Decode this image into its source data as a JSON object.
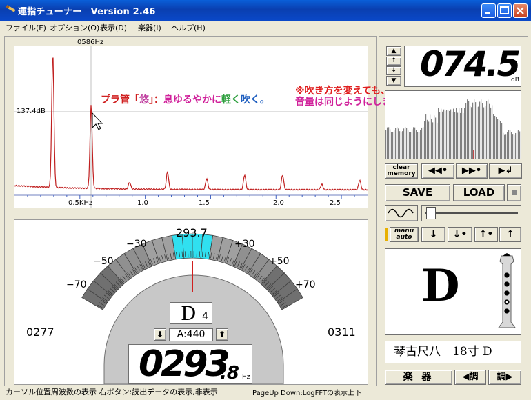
{
  "window": {
    "title": "運指チューナー　Version 2.46"
  },
  "menu": [
    "ファイル(F)",
    "オプション(O)",
    "表示(D)",
    "楽器(I)",
    "ヘルプ(H)"
  ],
  "spectrum": {
    "cursor_freq": "0586Hz",
    "cursor_db": "137.4dB",
    "x_ticks": [
      "0.5KHz",
      "1.0",
      "1.5",
      "2.0",
      "2.5"
    ],
    "annotation_left_a": "プラ管「",
    "annotation_left_b": "悠",
    "annotation_left_c": "」：",
    "annotation_left_d": "息ゆるやかに",
    "annotation_left_e": "軽く",
    "annotation_left_f": "吹く。",
    "annotation_right_1": "※吹き方を変えても、",
    "annotation_right_2": "音量は同じようにしました。",
    "annotation_arrow": "⇒"
  },
  "tuner": {
    "center_freq": "293.7",
    "labels": [
      "−70",
      "−50",
      "−30",
      "+30",
      "+50",
      "+70"
    ],
    "low_freq": "0277",
    "high_freq": "0311",
    "note": "D",
    "octave": "4",
    "a_ref": "A:440",
    "freq_main": "0293",
    "freq_frac": ".8",
    "freq_unit": "Hz"
  },
  "level": {
    "value": "074.5",
    "unit": "dB"
  },
  "controls": {
    "clear_memory_1": "clear",
    "clear_memory_2": "memory",
    "rewind": "◀◀•",
    "ffwd": "▶▶•",
    "play_return": "▶↲",
    "save": "SAVE",
    "load": "LOAD",
    "manu": "manu",
    "auto": "auto",
    "down": "↓",
    "down_plus": "↓•",
    "up_plus": "↑•",
    "up": "↑"
  },
  "fingering": {
    "note": "D"
  },
  "instrument": {
    "name": "琴古尺八　18寸 D",
    "instr_button": "楽 器",
    "prev_key": "◀調",
    "next_key": "調▶"
  },
  "status": {
    "left": "カーソル位置周波数の表示  右ボタン:読出データの表示,非表示",
    "right": "PageUp Down:LogFFTの表示上下"
  },
  "chart_data": {
    "type": "line",
    "title": "",
    "xlabel": "",
    "ylabel": "",
    "x_unit": "KHz",
    "xlim": [
      0,
      2.7
    ],
    "peaks_khz": [
      0.293,
      0.586,
      0.88,
      1.17,
      1.47,
      1.76,
      2.05,
      2.35,
      2.64
    ],
    "peak_levels_relative": [
      1.0,
      0.62,
      0.05,
      0.13,
      0.08,
      0.11,
      0.11,
      0.04,
      0.07
    ]
  }
}
